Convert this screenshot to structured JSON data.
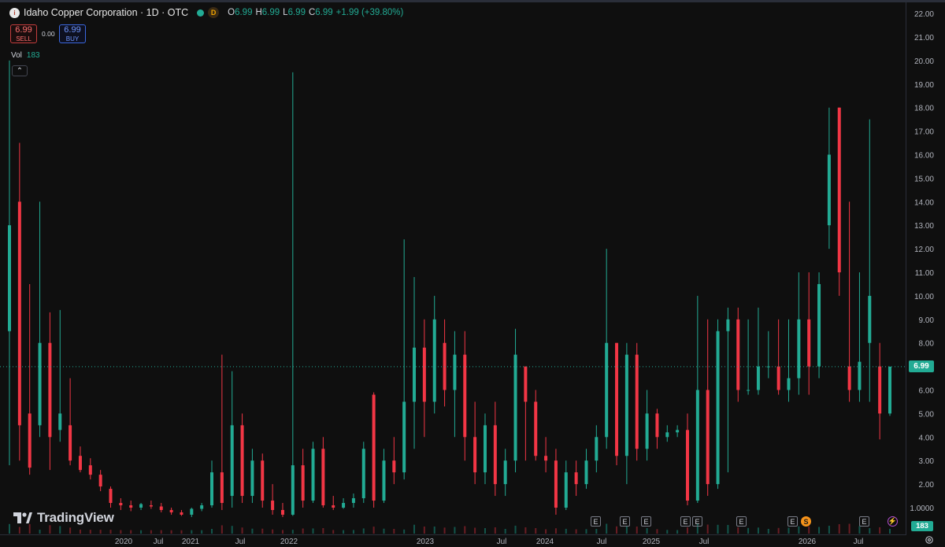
{
  "symbol": {
    "name": "Idaho Copper Corporation",
    "interval": "1D",
    "exchange": "OTC",
    "title": "Idaho Copper Corporation · 1D · OTC",
    "logo_letter": "i",
    "session_badge": "D",
    "status_dot_colors": [
      "#22ab94",
      "#f7931a"
    ]
  },
  "ohlc": {
    "o_label": "O",
    "o_value": "6.99",
    "h_label": "H",
    "h_value": "6.99",
    "l_label": "L",
    "l_value": "6.99",
    "c_label": "C",
    "c_value": "6.99",
    "change": "+1.99 (+39.80%)"
  },
  "trade": {
    "sell_price": "6.99",
    "sell_label": "SELL",
    "spread": "0.00",
    "buy_price": "6.99",
    "buy_label": "BUY"
  },
  "volume": {
    "label": "Vol",
    "value": "183"
  },
  "collapse_icon": "chevron-up-icon",
  "brand": {
    "name": "TradingView"
  },
  "price_scale": {
    "current_price_label": "6.99",
    "current_volume_label": "183",
    "settings_icon": "gear-icon"
  },
  "events": [
    {
      "type": "earnings",
      "label": "E"
    },
    {
      "type": "earnings",
      "label": "E"
    },
    {
      "type": "earnings",
      "label": "E"
    },
    {
      "type": "earnings",
      "label": "E"
    },
    {
      "type": "earnings",
      "label": "E"
    },
    {
      "type": "earnings",
      "label": "E"
    },
    {
      "type": "earnings",
      "label": "E"
    },
    {
      "type": "dividend",
      "label": "S"
    },
    {
      "type": "earnings",
      "label": "E"
    },
    {
      "type": "alert",
      "label": "⚡"
    }
  ],
  "colors": {
    "background": "#0f0f0f",
    "up": "#22ab94",
    "down": "#f23645",
    "price_line": "#22ab94"
  },
  "chart_data": {
    "type": "candlestick",
    "title": "Idaho Copper Corporation · 1D · OTC",
    "y_ticks": [
      "1.0000",
      "2.00",
      "3.00",
      "4.00",
      "5.00",
      "6.00",
      "7.00",
      "8.00",
      "9.00",
      "10.00",
      "11.00",
      "12.00",
      "13.00",
      "14.00",
      "15.00",
      "16.00",
      "17.00",
      "18.00",
      "19.00",
      "20.00",
      "21.00",
      "22.00"
    ],
    "x_ticks": [
      "2020",
      "Jul",
      "2021",
      "Jul",
      "2022",
      "2023",
      "Jul",
      "2024",
      "Jul",
      "2025",
      "Jul",
      "2026",
      "Jul"
    ],
    "ylim": [
      0,
      22.5
    ],
    "y_scale": "log",
    "grid": false,
    "last_price": 6.99,
    "candles": [
      {
        "date": "2019-03",
        "open": 8.5,
        "high": 20.0,
        "low": 2.8,
        "close": 13.0
      },
      {
        "date": "2019-04",
        "open": 14.0,
        "high": 16.5,
        "low": 3.0,
        "close": 4.5
      },
      {
        "date": "2019-05",
        "open": 5.0,
        "high": 10.5,
        "low": 2.4,
        "close": 2.7
      },
      {
        "date": "2019-06",
        "open": 4.5,
        "high": 14.0,
        "low": 4.0,
        "close": 8.0
      },
      {
        "date": "2019-07",
        "open": 8.0,
        "high": 9.3,
        "low": 2.6,
        "close": 4.0
      },
      {
        "date": "2019-08",
        "open": 4.3,
        "high": 9.4,
        "low": 3.8,
        "close": 5.0
      },
      {
        "date": "2019-09",
        "open": 4.5,
        "high": 6.5,
        "low": 2.8,
        "close": 3.0
      },
      {
        "date": "2019-10",
        "open": 3.2,
        "high": 3.6,
        "low": 2.5,
        "close": 2.6
      },
      {
        "date": "2019-11",
        "open": 2.8,
        "high": 3.1,
        "low": 2.2,
        "close": 2.4
      },
      {
        "date": "2019-12",
        "open": 2.4,
        "high": 2.6,
        "low": 1.7,
        "close": 1.9
      },
      {
        "date": "2020-01",
        "open": 1.8,
        "high": 1.9,
        "low": 1.0,
        "close": 1.2
      },
      {
        "date": "2020-02",
        "open": 1.2,
        "high": 1.4,
        "low": 0.9,
        "close": 1.1
      },
      {
        "date": "2020-03",
        "open": 1.1,
        "high": 1.3,
        "low": 0.85,
        "close": 1.0
      },
      {
        "date": "2020-04",
        "open": 1.0,
        "high": 1.2,
        "low": 0.9,
        "close": 1.15
      },
      {
        "date": "2020-05",
        "open": 1.1,
        "high": 1.3,
        "low": 0.95,
        "close": 1.05
      },
      {
        "date": "2020-06",
        "open": 1.05,
        "high": 1.2,
        "low": 0.8,
        "close": 0.9
      },
      {
        "date": "2020-07",
        "open": 0.9,
        "high": 1.0,
        "low": 0.7,
        "close": 0.8
      },
      {
        "date": "2020-08",
        "open": 0.8,
        "high": 0.9,
        "low": 0.65,
        "close": 0.7
      },
      {
        "date": "2020-09",
        "open": 0.7,
        "high": 1.0,
        "low": 0.6,
        "close": 0.95
      },
      {
        "date": "2020-10",
        "open": 0.95,
        "high": 1.2,
        "low": 0.85,
        "close": 1.1
      },
      {
        "date": "2020-11",
        "open": 1.1,
        "high": 3.0,
        "low": 1.0,
        "close": 2.5
      },
      {
        "date": "2020-12",
        "open": 2.5,
        "high": 7.5,
        "low": 0.9,
        "close": 1.2
      },
      {
        "date": "2021-01",
        "open": 1.5,
        "high": 6.8,
        "low": 1.0,
        "close": 4.5
      },
      {
        "date": "2021-02",
        "open": 4.5,
        "high": 5.0,
        "low": 1.2,
        "close": 1.5
      },
      {
        "date": "2021-03",
        "open": 1.5,
        "high": 3.5,
        "low": 1.2,
        "close": 3.0
      },
      {
        "date": "2021-04",
        "open": 3.0,
        "high": 3.3,
        "low": 1.0,
        "close": 1.3
      },
      {
        "date": "2021-05",
        "open": 1.3,
        "high": 2.0,
        "low": 0.7,
        "close": 0.9
      },
      {
        "date": "2021-06",
        "open": 0.9,
        "high": 1.2,
        "low": 0.6,
        "close": 0.7
      },
      {
        "date": "2021-07",
        "open": 0.7,
        "high": 19.5,
        "low": 0.65,
        "close": 2.8
      },
      {
        "date": "2021-08",
        "open": 2.8,
        "high": 3.5,
        "low": 1.0,
        "close": 1.3
      },
      {
        "date": "2021-09",
        "open": 1.3,
        "high": 3.8,
        "low": 1.2,
        "close": 3.5
      },
      {
        "date": "2021-10",
        "open": 3.5,
        "high": 4.0,
        "low": 1.0,
        "close": 1.1
      },
      {
        "date": "2021-11",
        "open": 1.1,
        "high": 1.5,
        "low": 0.9,
        "close": 1.0
      },
      {
        "date": "2021-12",
        "open": 1.0,
        "high": 1.4,
        "low": 0.95,
        "close": 1.2
      },
      {
        "date": "2022-01",
        "open": 1.2,
        "high": 1.6,
        "low": 1.0,
        "close": 1.4
      },
      {
        "date": "2022-02",
        "open": 1.4,
        "high": 3.8,
        "low": 1.2,
        "close": 3.5
      },
      {
        "date": "2022-03",
        "open": 5.8,
        "high": 5.9,
        "low": 1.0,
        "close": 1.3
      },
      {
        "date": "2022-04",
        "open": 1.3,
        "high": 3.5,
        "low": 1.2,
        "close": 3.0
      },
      {
        "date": "2022-05",
        "open": 3.0,
        "high": 4.0,
        "low": 2.0,
        "close": 2.5
      },
      {
        "date": "2022-06",
        "open": 2.5,
        "high": 12.4,
        "low": 2.2,
        "close": 5.5
      },
      {
        "date": "2022-07",
        "open": 5.5,
        "high": 10.8,
        "low": 3.5,
        "close": 7.8
      },
      {
        "date": "2022-08",
        "open": 7.8,
        "high": 9.0,
        "low": 4.0,
        "close": 5.5
      },
      {
        "date": "2022-09",
        "open": 5.5,
        "high": 10.0,
        "low": 5.0,
        "close": 9.0
      },
      {
        "date": "2022-10",
        "open": 8.0,
        "high": 9.0,
        "low": 5.3,
        "close": 6.0
      },
      {
        "date": "2022-11",
        "open": 6.0,
        "high": 8.5,
        "low": 4.0,
        "close": 7.5
      },
      {
        "date": "2022-12",
        "open": 7.5,
        "high": 8.5,
        "low": 3.0,
        "close": 4.0
      },
      {
        "date": "2023-01",
        "open": 4.0,
        "high": 5.5,
        "low": 2.0,
        "close": 2.5
      },
      {
        "date": "2023-02",
        "open": 2.5,
        "high": 5.0,
        "low": 2.0,
        "close": 4.5
      },
      {
        "date": "2023-03",
        "open": 4.5,
        "high": 5.5,
        "low": 1.5,
        "close": 2.0
      },
      {
        "date": "2023-04",
        "open": 2.0,
        "high": 3.5,
        "low": 1.5,
        "close": 3.0
      },
      {
        "date": "2023-05",
        "open": 3.0,
        "high": 8.6,
        "low": 2.5,
        "close": 7.5
      },
      {
        "date": "2023-06",
        "open": 7.0,
        "high": 7.0,
        "low": 3.0,
        "close": 5.5
      },
      {
        "date": "2023-07",
        "open": 5.5,
        "high": 6.0,
        "low": 3.0,
        "close": 3.2
      },
      {
        "date": "2023-08",
        "open": 3.2,
        "high": 4.0,
        "low": 2.5,
        "close": 3.0
      },
      {
        "date": "2023-09",
        "open": 3.0,
        "high": 3.5,
        "low": 0.7,
        "close": 1.0
      },
      {
        "date": "2023-10",
        "open": 1.0,
        "high": 3.0,
        "low": 0.9,
        "close": 2.5
      },
      {
        "date": "2023-11",
        "open": 2.5,
        "high": 3.0,
        "low": 1.5,
        "close": 2.0
      },
      {
        "date": "2023-12",
        "open": 2.0,
        "high": 3.5,
        "low": 1.8,
        "close": 3.0
      },
      {
        "date": "2024-01",
        "open": 3.0,
        "high": 4.5,
        "low": 2.5,
        "close": 4.0
      },
      {
        "date": "2024-02",
        "open": 4.0,
        "high": 12.0,
        "low": 3.5,
        "close": 8.0
      },
      {
        "date": "2024-03",
        "open": 8.0,
        "high": 8.0,
        "low": 2.8,
        "close": 3.2
      },
      {
        "date": "2024-04",
        "open": 3.2,
        "high": 8.0,
        "low": 2.0,
        "close": 7.5
      },
      {
        "date": "2024-05",
        "open": 7.5,
        "high": 8.0,
        "low": 3.0,
        "close": 3.5
      },
      {
        "date": "2024-06",
        "open": 3.5,
        "high": 6.0,
        "low": 3.0,
        "close": 5.0
      },
      {
        "date": "2024-07",
        "open": 5.0,
        "high": 5.2,
        "low": 3.5,
        "close": 4.0
      },
      {
        "date": "2024-08",
        "open": 4.0,
        "high": 4.5,
        "low": 3.8,
        "close": 4.2
      },
      {
        "date": "2024-09",
        "open": 4.2,
        "high": 4.5,
        "low": 4.0,
        "close": 4.3
      },
      {
        "date": "2024-10",
        "open": 4.3,
        "high": 5.0,
        "low": 1.1,
        "close": 1.3
      },
      {
        "date": "2024-11",
        "open": 1.3,
        "high": 10.0,
        "low": 1.2,
        "close": 6.0
      },
      {
        "date": "2024-12",
        "open": 6.0,
        "high": 9.0,
        "low": 1.5,
        "close": 2.0
      },
      {
        "date": "2025-01",
        "open": 2.0,
        "high": 9.0,
        "low": 1.8,
        "close": 8.5
      },
      {
        "date": "2025-02",
        "open": 8.5,
        "high": 9.5,
        "low": 2.5,
        "close": 9.0
      },
      {
        "date": "2025-03",
        "open": 9.0,
        "high": 9.5,
        "low": 5.5,
        "close": 6.0
      },
      {
        "date": "2025-04",
        "open": 6.0,
        "high": 9.0,
        "low": 5.8,
        "close": 6.0
      },
      {
        "date": "2025-05",
        "open": 6.0,
        "high": 9.5,
        "low": 5.8,
        "close": 7.0
      },
      {
        "date": "2025-06",
        "open": 7.0,
        "high": 8.5,
        "low": 6.5,
        "close": 7.0
      },
      {
        "date": "2025-07",
        "open": 7.0,
        "high": 9.0,
        "low": 5.8,
        "close": 6.0
      },
      {
        "date": "2025-08",
        "open": 6.0,
        "high": 9.0,
        "low": 5.5,
        "close": 6.5
      },
      {
        "date": "2025-09",
        "open": 6.5,
        "high": 11.0,
        "low": 5.8,
        "close": 9.0
      },
      {
        "date": "2025-10",
        "open": 9.0,
        "high": 11.0,
        "low": 5.8,
        "close": 7.0
      },
      {
        "date": "2025-11",
        "open": 7.0,
        "high": 11.0,
        "low": 6.5,
        "close": 10.5
      },
      {
        "date": "2025-12",
        "open": 13.0,
        "high": 18.0,
        "low": 12.0,
        "close": 16.0
      },
      {
        "date": "2026-01",
        "open": 18.0,
        "high": 18.0,
        "low": 10.0,
        "close": 11.0
      },
      {
        "date": "2026-02",
        "open": 7.0,
        "high": 14.0,
        "low": 5.5,
        "close": 6.0
      },
      {
        "date": "2026-03",
        "open": 6.0,
        "high": 11.0,
        "low": 5.5,
        "close": 7.2
      },
      {
        "date": "2026-04",
        "open": 8.0,
        "high": 17.5,
        "low": 5.5,
        "close": 10.0
      },
      {
        "date": "2026-05",
        "open": 7.0,
        "high": 8.0,
        "low": 3.9,
        "close": 5.0
      },
      {
        "date": "2026-06",
        "open": 5.0,
        "high": 7.0,
        "low": 4.9,
        "close": 6.99
      }
    ]
  }
}
